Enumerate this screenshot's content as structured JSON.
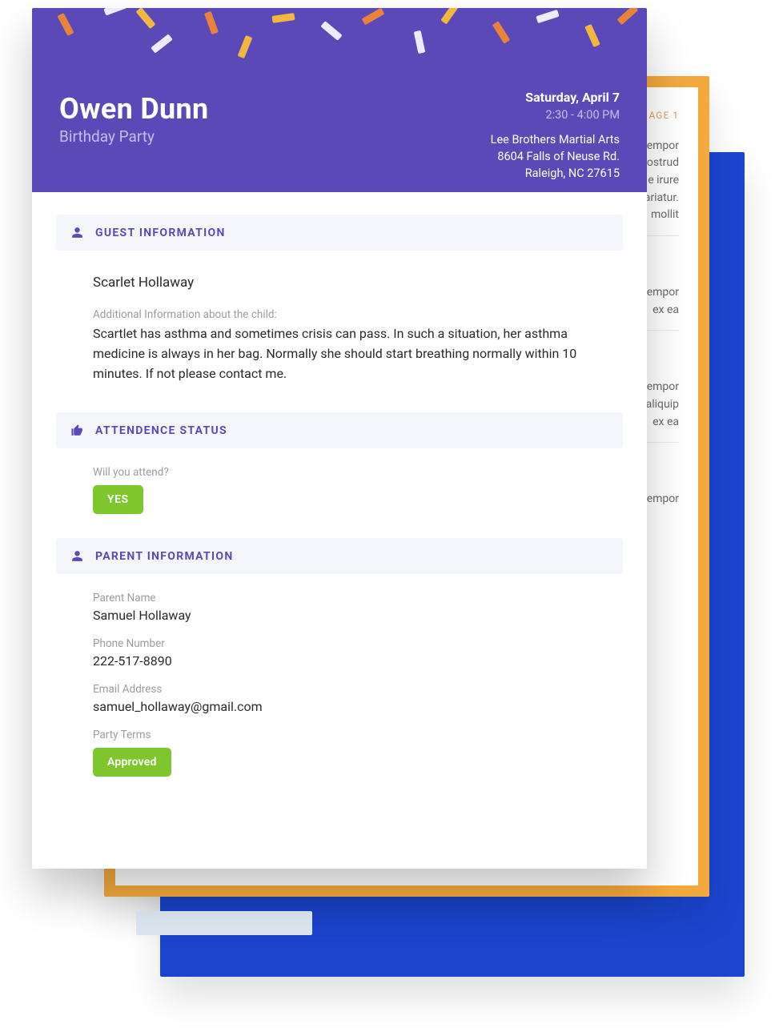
{
  "background": {
    "page_label": "AGE 1",
    "paragraphs": [
      "empor\nostrud\ne irure\nariatur.\n mollit",
      "empor\n ex ea",
      "empor\naliquip\n ex ea",
      "empor"
    ]
  },
  "header": {
    "name": "Owen Dunn",
    "subtitle": "Birthday Party",
    "date": "Saturday, April 7",
    "time": "2:30 - 4:00 PM",
    "venue": "Lee Brothers Martial Arts",
    "address1": "8604 Falls of Neuse Rd.",
    "address2": "Raleigh, NC 27615",
    "confetti_colors": {
      "yellow": "#f2b73f",
      "orange": "#e9833c",
      "white": "#eeeaf7"
    }
  },
  "sections": {
    "guest": {
      "title": "GUEST INFORMATION",
      "name": "Scarlet Hollaway",
      "additional_label": "Additional Information about the child:",
      "additional_text": "Scartlet has asthma and sometimes crisis can pass. In such a situation, her asthma medicine is always in her bag. Normally she should start breathing normally within 10 minutes. If not please contact me."
    },
    "attendance": {
      "title": "ATTENDENCE STATUS",
      "question": "Will you attend?",
      "answer": "YES"
    },
    "parent": {
      "title": "PARENT INFORMATION",
      "name_label": "Parent Name",
      "name": "Samuel Hollaway",
      "phone_label": "Phone Number",
      "phone": "222-517-8890",
      "email_label": "Email Address",
      "email": "samuel_hollaway@gmail.com",
      "terms_label": "Party Terms",
      "terms_status": "Approved"
    }
  }
}
